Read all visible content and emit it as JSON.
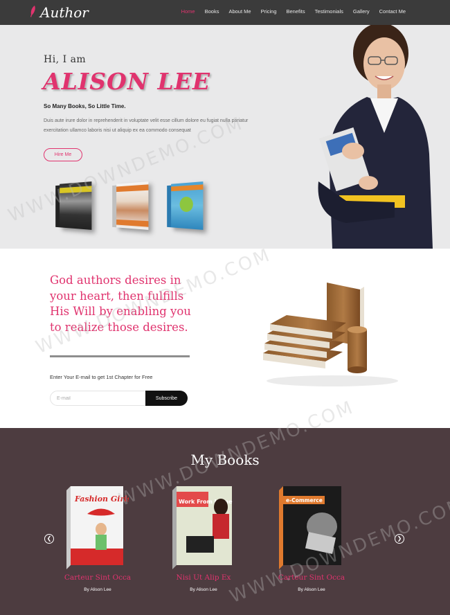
{
  "nav": {
    "logo_text": "Author",
    "items": [
      {
        "label": "Home",
        "active": true
      },
      {
        "label": "Books",
        "active": false
      },
      {
        "label": "About Me",
        "active": false
      },
      {
        "label": "Pricing",
        "active": false
      },
      {
        "label": "Benefits",
        "active": false
      },
      {
        "label": "Testimonials",
        "active": false
      },
      {
        "label": "Gallery",
        "active": false
      },
      {
        "label": "Contact Me",
        "active": false
      }
    ]
  },
  "hero": {
    "greeting": "Hi, I am",
    "name": "ALISON LEE",
    "tagline": "So Many Books, So Little Time.",
    "paragraph": "Duis aute irure dolor in reprehenderit in voluptate velit esse cillum dolore eu fugiat nulla pariatur exercitation ullamco laboris nisi ut aliquip ex ea commodo consequat",
    "button_label": "Hire Me",
    "mini_books": [
      "book-cover-1",
      "book-cover-2",
      "book-cover-3"
    ]
  },
  "signup": {
    "quote": "God authors desires in your heart, then fulfills His Will by enabling you to realize those desires.",
    "label": "Enter Your E-mail to get 1st Chapter for Free",
    "input_placeholder": "E-mail",
    "button_label": "Subscribe"
  },
  "books": {
    "title": "My Books",
    "items": [
      {
        "title": "Carteur Sint Occa",
        "author": "By Alison Lee",
        "cover_text": "Fashion Girls"
      },
      {
        "title": "Nisi Ut Alip Ex",
        "author": "By Alison Lee",
        "cover_text": "Work From Home"
      },
      {
        "title": "Carteur Sint Occa",
        "author": "By Alison Lee",
        "cover_text": "e-Commerce"
      }
    ]
  },
  "watermark": "WWW.DOWNDEMO.COM",
  "colors": {
    "accent": "#e0336e",
    "nav_bg": "#3b3b3b",
    "hero_bg": "#e9e9ea",
    "books_bg": "#4d3c40"
  }
}
